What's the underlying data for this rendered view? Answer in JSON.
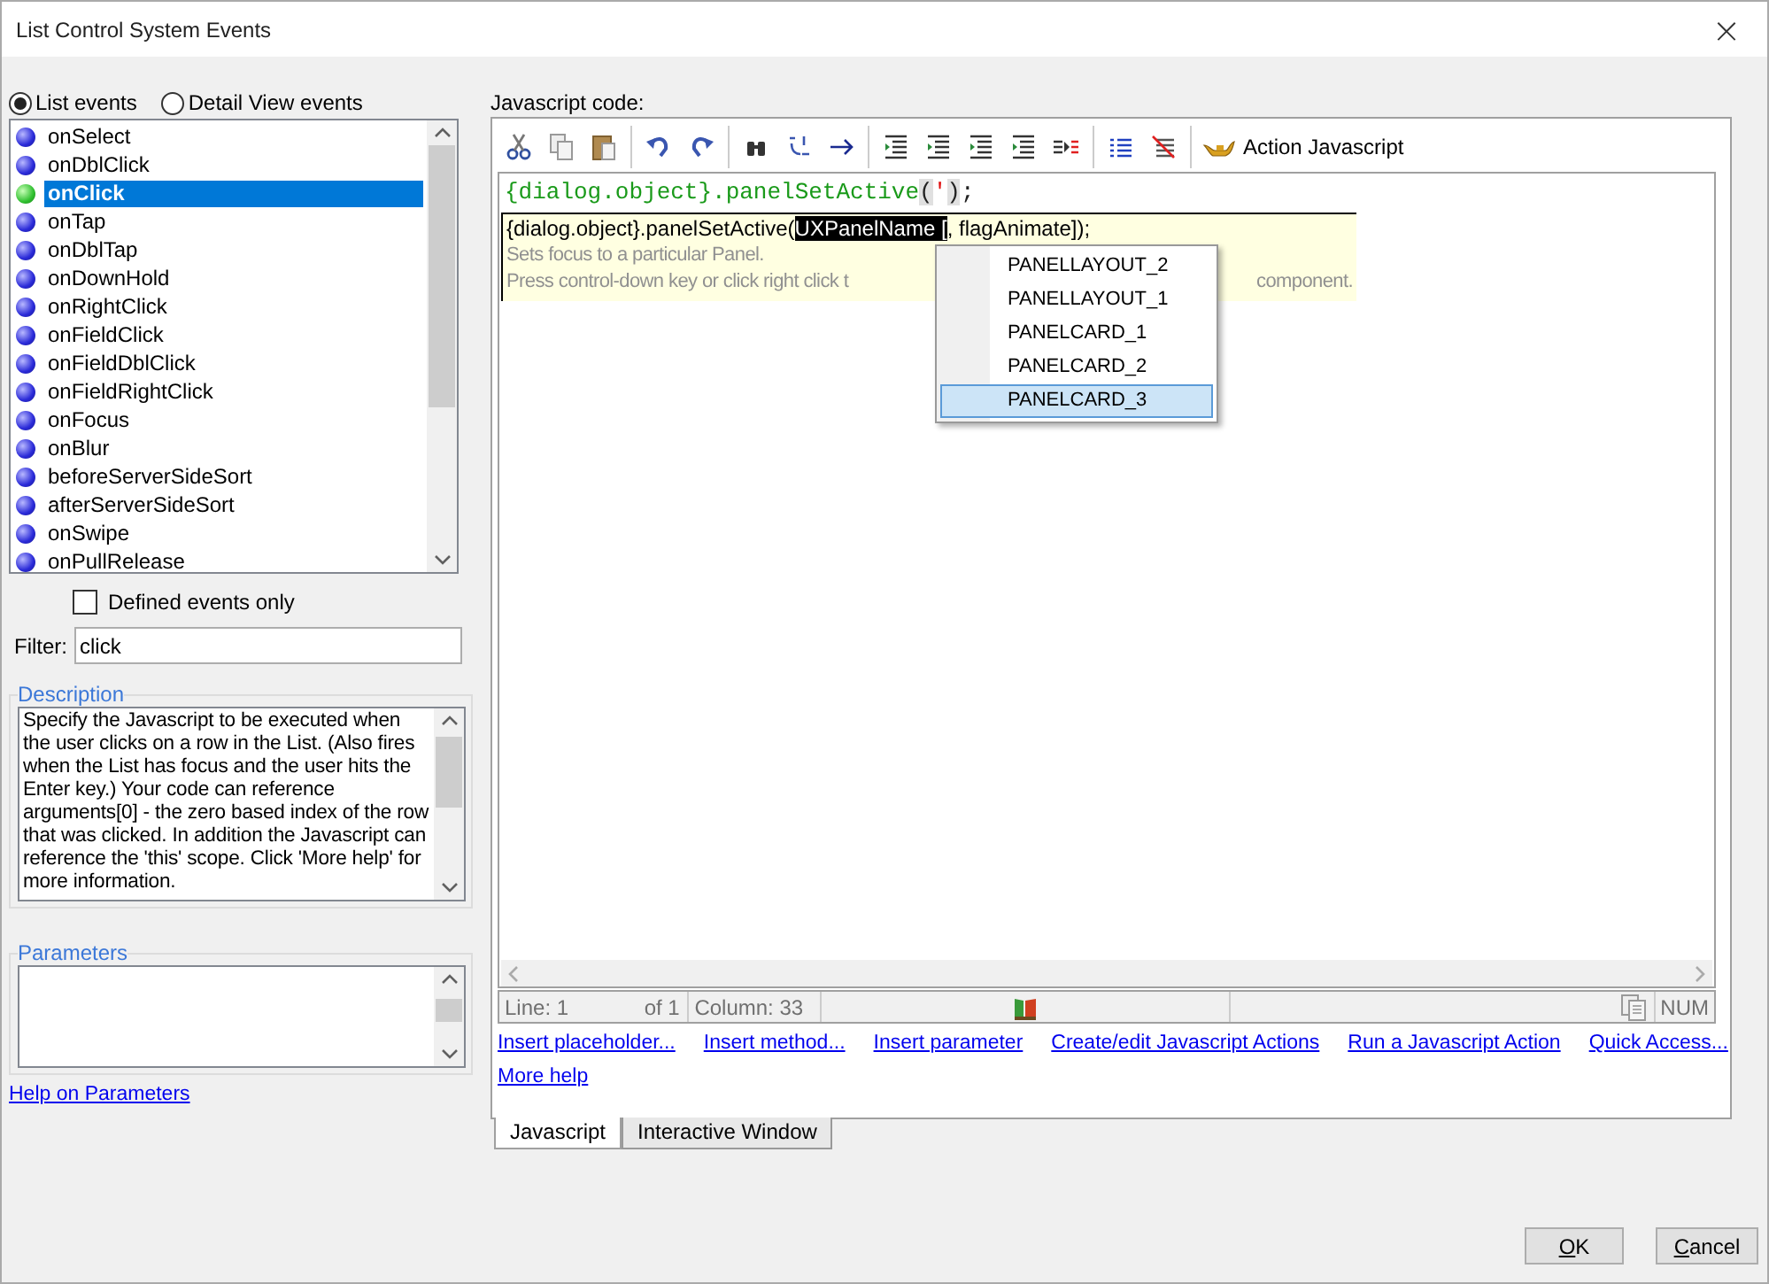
{
  "window": {
    "title": "List Control System Events",
    "close": "×"
  },
  "event_modes": [
    {
      "label": "List events",
      "selected": true
    },
    {
      "label": "Detail View events",
      "selected": false
    }
  ],
  "events": [
    {
      "name": "onSelect",
      "defined": false,
      "selected": false
    },
    {
      "name": "onDblClick",
      "defined": false,
      "selected": false
    },
    {
      "name": "onClick",
      "defined": true,
      "selected": true
    },
    {
      "name": "onTap",
      "defined": false,
      "selected": false
    },
    {
      "name": "onDblTap",
      "defined": false,
      "selected": false
    },
    {
      "name": "onDownHold",
      "defined": false,
      "selected": false
    },
    {
      "name": "onRightClick",
      "defined": false,
      "selected": false
    },
    {
      "name": "onFieldClick",
      "defined": false,
      "selected": false
    },
    {
      "name": "onFieldDblClick",
      "defined": false,
      "selected": false
    },
    {
      "name": "onFieldRightClick",
      "defined": false,
      "selected": false
    },
    {
      "name": "onFocus",
      "defined": false,
      "selected": false
    },
    {
      "name": "onBlur",
      "defined": false,
      "selected": false
    },
    {
      "name": "beforeServerSideSort",
      "defined": false,
      "selected": false
    },
    {
      "name": "afterServerSideSort",
      "defined": false,
      "selected": false
    },
    {
      "name": "onSwipe",
      "defined": false,
      "selected": false
    },
    {
      "name": "onPullRelease",
      "defined": false,
      "selected": false
    }
  ],
  "defined_only": {
    "label": "Defined events only",
    "checked": false
  },
  "filter": {
    "label": "Filter:",
    "value": "click"
  },
  "description": {
    "title": "Description",
    "text": "Specify the Javascript to be executed when the user clicks on a row in the List. (Also fires when the List has focus and the user hits the Enter key.)  Your code can reference arguments[0]  - the zero based index of the row that was clicked. In addition the Javascript can reference the 'this' scope. Click 'More help' for more information."
  },
  "parameters": {
    "title": "Parameters"
  },
  "help_link": "Help on Parameters",
  "code_label": "Javascript code:",
  "toolbar": {
    "action_button": "Action Javascript"
  },
  "code_line": [
    {
      "text": "{dialog.object}.panelSetActive",
      "kind": "ident"
    },
    {
      "text": "(",
      "kind": "brace"
    },
    {
      "text": "'",
      "kind": "string"
    },
    {
      "text": ")",
      "kind": "brace"
    },
    {
      "text": ";",
      "kind": "plain"
    }
  ],
  "tooltip": {
    "signature_start": "{dialog.object}.panelSetActive(",
    "signature_param": "UXPanelName [",
    "signature_end": ", flagAnimate]);",
    "summary": "Sets focus to a particular Panel.",
    "hint_start": "Press control-down key or click right click t",
    "hint_end": "component."
  },
  "completions": [
    {
      "label": "PANELLAYOUT_2",
      "selected": false
    },
    {
      "label": "PANELLAYOUT_1",
      "selected": false
    },
    {
      "label": "PANELCARD_1",
      "selected": false
    },
    {
      "label": "PANELCARD_2",
      "selected": false
    },
    {
      "label": "PANELCARD_3",
      "selected": true
    }
  ],
  "status_bar": {
    "line": "Line: 1",
    "of": "of 1",
    "column": "Column: 33",
    "mode": "NUM"
  },
  "links": [
    "Insert placeholder...",
    "Insert method...",
    "Insert parameter",
    "Create/edit Javascript Actions",
    "Run a Javascript Action",
    "Quick Access..."
  ],
  "more_help": "More help",
  "tabs": [
    {
      "label": "Javascript",
      "selected": true
    },
    {
      "label": "Interactive Window",
      "selected": false
    }
  ],
  "buttons": [
    {
      "label": "OK"
    },
    {
      "label": "Cancel"
    }
  ]
}
